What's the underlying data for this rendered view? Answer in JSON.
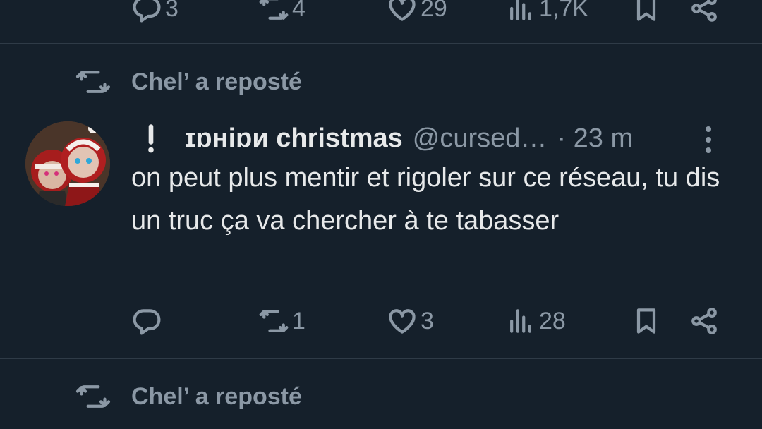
{
  "prev_tweet": {
    "actions": {
      "reply_count": "3",
      "retweet_count": "4",
      "like_count": "29",
      "view_count": "1,7K"
    }
  },
  "repost_1": {
    "label": "Chel’ a reposté"
  },
  "tweet": {
    "warning_glyph": "❕",
    "display_name": "ɪɒʜiɒᴎ christmas",
    "handle": "@cursed…",
    "time": "· 23 m",
    "text": "on peut plus mentir et rigoler sur ce réseau, tu dis un truc ça va chercher à te tabasser",
    "actions": {
      "reply_count": "",
      "retweet_count": "1",
      "like_count": "3",
      "view_count": "28"
    }
  },
  "repost_2": {
    "label": "Chel’ a reposté"
  },
  "icons": {
    "reply": "reply-icon",
    "retweet": "retweet-icon",
    "like": "heart-icon",
    "views": "views-icon",
    "bookmark": "bookmark-icon",
    "share": "share-icon",
    "more": "more-vertical-icon",
    "warning": "exclamation-icon"
  },
  "colors": {
    "background": "#15202b",
    "text": "#e7e9ea",
    "muted": "#8b98a5",
    "divider": "#2f3b47"
  }
}
